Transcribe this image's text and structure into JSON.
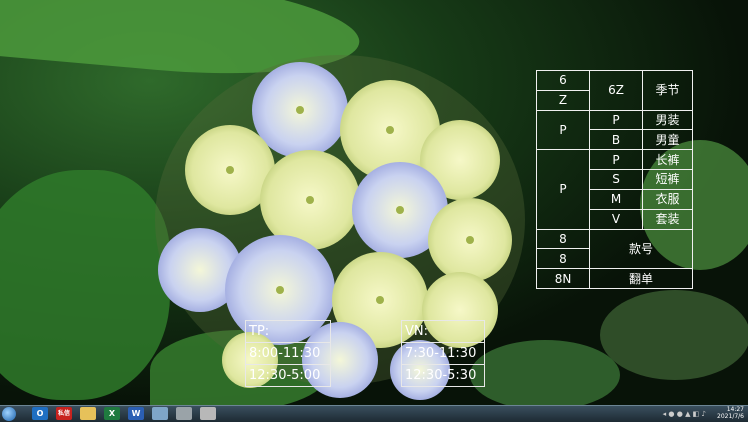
{
  "size_table": {
    "rows": [
      {
        "c1": "6",
        "c2": "6Z",
        "c3": "季节"
      },
      {
        "c1": "Z"
      },
      {
        "c1": "P",
        "c2": "P",
        "c3": "男装"
      },
      {
        "c2": "B",
        "c3": "男童"
      },
      {
        "c1": "P",
        "c2": "P",
        "c3": "长裤"
      },
      {
        "c2": "S",
        "c3": "短裤"
      },
      {
        "c2": "M",
        "c3": "衣服"
      },
      {
        "c2": "V",
        "c3": "套装"
      },
      {
        "c1": "8",
        "c23": "款号"
      },
      {
        "c1": "8"
      },
      {
        "c1": "8N",
        "c23": "翻单"
      }
    ]
  },
  "hours_tp": {
    "title": "TP:",
    "line1": "8:00-11:30",
    "line2": "12:30-5:00"
  },
  "hours_vn": {
    "title": "VN:",
    "line1": "7:30-11:30",
    "line2": "12:30-5:30"
  },
  "taskbar": {
    "items": [
      "O",
      "私信",
      "",
      "X",
      "W",
      "",
      "",
      ""
    ],
    "clock_time": "14:27",
    "clock_date": "2021/7/6"
  },
  "colors": {
    "taskbar": "#2a3a45",
    "table_border": "#f0f0f0"
  }
}
